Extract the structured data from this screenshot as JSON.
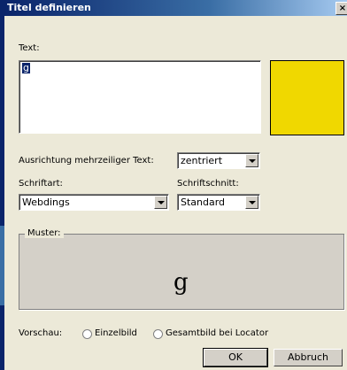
{
  "window": {
    "title": "Titel definieren",
    "close_glyph": "×"
  },
  "text_section": {
    "label": "Text:",
    "value": "g"
  },
  "color_swatch": {
    "color": "#f0d800"
  },
  "alignment": {
    "label": "Ausrichtung mehrzeiliger Text:",
    "selected": "zentriert"
  },
  "font": {
    "label": "Schriftart:",
    "selected": "Webdings"
  },
  "style": {
    "label": "Schriftschnitt:",
    "selected": "Standard"
  },
  "preview_group": {
    "legend": "Muster:",
    "sample_text": "g"
  },
  "view": {
    "label": "Vorschau:",
    "options": [
      "Einzelbild",
      "Gesamtbild bei Locator"
    ]
  },
  "buttons": {
    "ok": "OK",
    "cancel": "Abbruch"
  }
}
